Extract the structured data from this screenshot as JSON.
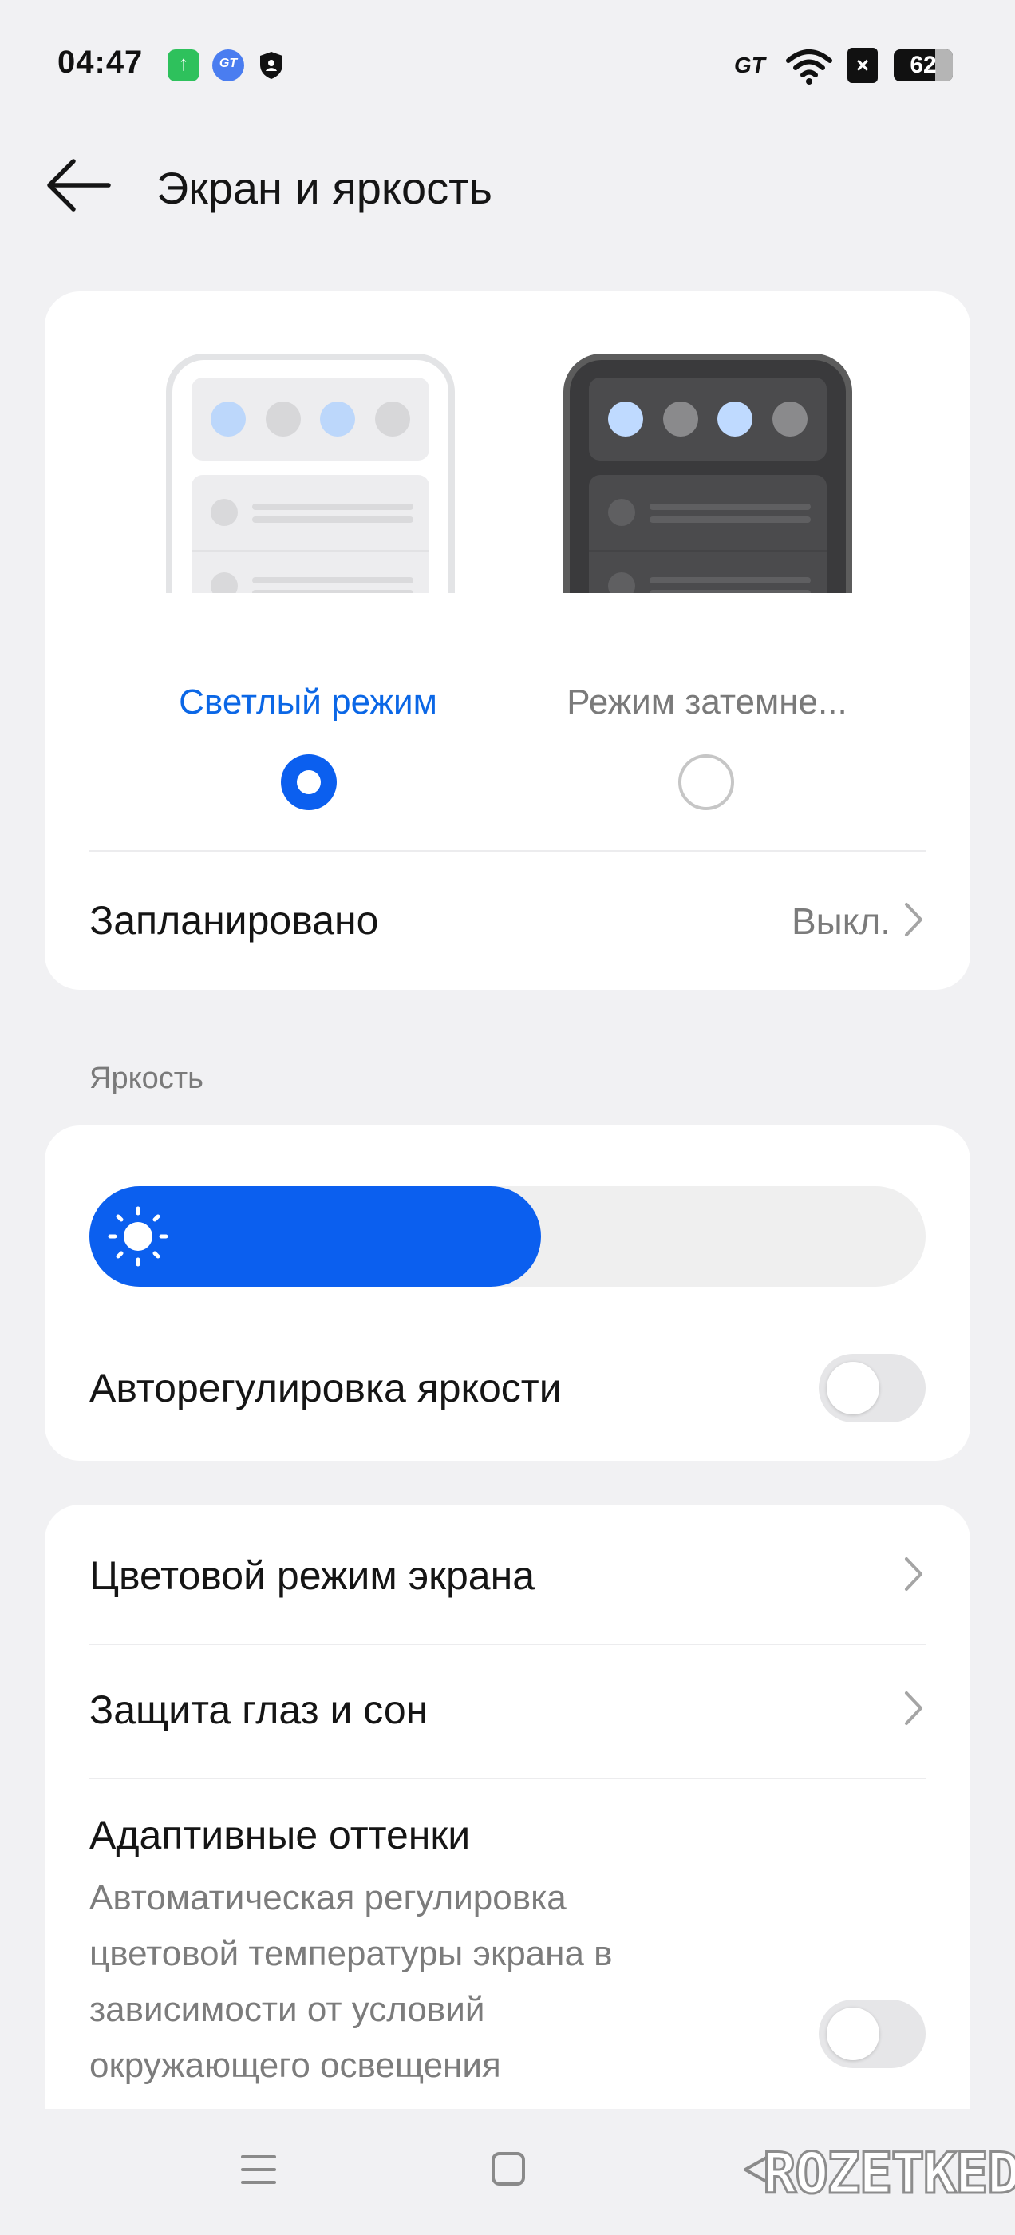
{
  "status_bar": {
    "time": "04:47",
    "left_icons": [
      "upload-icon",
      "gt-app-icon",
      "shield-icon"
    ],
    "right_gt": "GT",
    "battery": "62"
  },
  "header": {
    "title": "Экран и яркость"
  },
  "theme": {
    "light_label": "Светлый режим",
    "dark_label": "Режим затемне...",
    "selected": "light",
    "scheduled_label": "Запланировано",
    "scheduled_value": "Выкл."
  },
  "brightness": {
    "section_title": "Яркость",
    "level_percent": 54,
    "auto_label": "Авторегулировка яркости",
    "auto_enabled": false
  },
  "display": {
    "color_mode_label": "Цветовой режим экрана",
    "eye_protection_label": "Защита глаз и сон",
    "adaptive_title": "Адаптивные оттенки",
    "adaptive_desc": "Автоматическая регулировка цветовой температуры экрана в зависимости от условий окружающего освещения",
    "adaptive_enabled": false
  },
  "colors": {
    "accent": "#0b5fef",
    "background": "#f1f1f3",
    "card": "#ffffff"
  },
  "watermark": "ROZETKED"
}
